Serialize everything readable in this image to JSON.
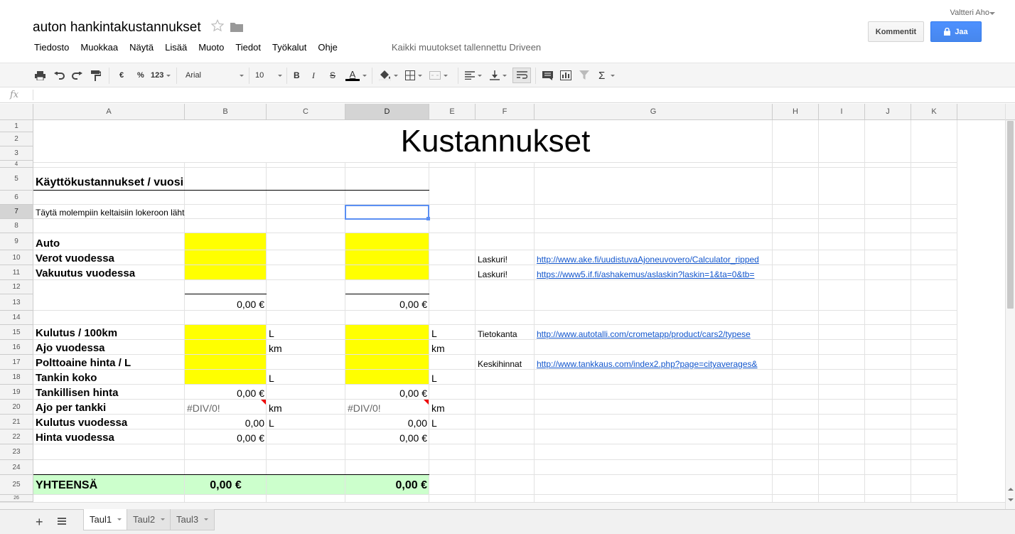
{
  "header": {
    "title": "auton hankintakustannukset",
    "user": "Valtteri Aho",
    "comments_label": "Kommentit",
    "share_label": "Jaa",
    "save_status": "Kaikki muutokset tallennettu Driveen"
  },
  "menu": [
    "Tiedosto",
    "Muokkaa",
    "Näytä",
    "Lisää",
    "Muoto",
    "Tiedot",
    "Työkalut",
    "Ohje"
  ],
  "toolbar": {
    "currency": "€",
    "percent": "%",
    "number_format": "123",
    "font": "Arial",
    "font_size": "10",
    "bold": "B",
    "italic": "I",
    "strike": "S",
    "text_color": "A",
    "functions": "Σ",
    "text_color_hex": "#000000"
  },
  "formula_bar": {
    "fx": "fx",
    "value": ""
  },
  "columns": [
    "A",
    "B",
    "C",
    "D",
    "E",
    "F",
    "G",
    "H",
    "I",
    "J",
    "K"
  ],
  "rows": [
    "1",
    "2",
    "3",
    "4",
    "5",
    "6",
    "7",
    "8",
    "9",
    "10",
    "11",
    "12",
    "13",
    "14",
    "15",
    "16",
    "17",
    "18",
    "19",
    "20",
    "21",
    "22",
    "23",
    "24",
    "25",
    "26"
  ],
  "cells": {
    "title": "Kustannukset",
    "r5_a": "Käyttökustannukset / vuosi",
    "r7_a": "Täytä molempiin keltaisiin lokeroon lähtötiedot",
    "r9_a": "Auto",
    "r10_a": "Verot vuodessa",
    "r11_a": "Vakuutus vuodessa",
    "r13_b": "0,00 €",
    "r13_d": "0,00 €",
    "r15_a": "Kulutus / 100km",
    "r16_a": "Ajo vuodessa",
    "r17_a": "Polttoaine hinta / L",
    "r18_a": "Tankin koko",
    "r19_a": "Tankillisen hinta",
    "r20_a": "Ajo per tankki",
    "r21_a": "Kulutus vuodessa",
    "r22_a": "Hinta vuodessa",
    "r25_a": "YHTEENSÄ",
    "unit_l": "L",
    "unit_km": "km",
    "r19_b": "0,00 €",
    "r19_d": "0,00 €",
    "r20_b": "#DIV/0!",
    "r20_d": "#DIV/0!",
    "r21_b": "0,00",
    "r21_d": "0,00",
    "r22_b": "0,00 €",
    "r22_d": "0,00 €",
    "r25_b": "0,00 €",
    "r25_d": "0,00 €",
    "r10_f": "Laskuri!",
    "r11_f": "Laskuri!",
    "r15_f": "Tietokanta",
    "r17_f": "Keskihinnat",
    "r10_g": "http://www.ake.fi/uudistuvaAjoneuvovero/Calculator_ripped",
    "r11_g": "https://www5.if.fi/ashakemus/aslaskin?laskin=1&ta=0&tb=",
    "r15_g": "http://www.autotalli.com/crometapp/product/cars2/typese",
    "r17_g": "http://www.tankkaus.com/index2.php?page=cityaverages&"
  },
  "sheets": [
    "Taul1",
    "Taul2",
    "Taul3"
  ],
  "colors": {
    "input_yellow": "#ffff00",
    "total_green": "#ccffcc",
    "link": "#1155cc",
    "share_blue": "#4d90fe"
  }
}
